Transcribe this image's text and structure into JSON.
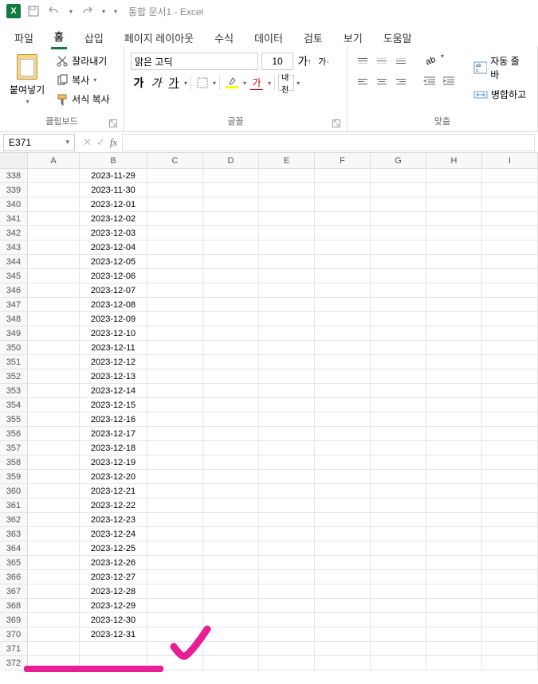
{
  "title": "통합 문서1  -  Excel",
  "tabs": [
    "파일",
    "홈",
    "삽입",
    "페이지 레이아웃",
    "수식",
    "데이터",
    "검토",
    "보기",
    "도움말"
  ],
  "active_tab": "홈",
  "clipboard": {
    "paste": "붙여넣기",
    "cut": "잘라내기",
    "copy": "복사",
    "format_painter": "서식 복사",
    "group_label": "클립보드"
  },
  "font": {
    "name": "맑은 고딕",
    "size": "10",
    "grow": "가",
    "shrink": "가",
    "bold": "가",
    "italic": "가",
    "underline": "가",
    "ruby": "내천",
    "group_label": "글꼴"
  },
  "align": {
    "wrap": "자동 줄 바",
    "merge": "병합하고",
    "group_label": "맞춤"
  },
  "name_box": "E371",
  "formula": "",
  "columns": [
    "A",
    "B",
    "C",
    "D",
    "E",
    "F",
    "G",
    "H",
    "I"
  ],
  "row_start": 338,
  "row_end": 372,
  "dates_start_row": 338,
  "dates": [
    "2023-11-29",
    "2023-11-30",
    "2023-12-01",
    "2023-12-02",
    "2023-12-03",
    "2023-12-04",
    "2023-12-05",
    "2023-12-06",
    "2023-12-07",
    "2023-12-08",
    "2023-12-09",
    "2023-12-10",
    "2023-12-11",
    "2023-12-12",
    "2023-12-13",
    "2023-12-14",
    "2023-12-15",
    "2023-12-16",
    "2023-12-17",
    "2023-12-18",
    "2023-12-19",
    "2023-12-20",
    "2023-12-21",
    "2023-12-22",
    "2023-12-23",
    "2023-12-24",
    "2023-12-25",
    "2023-12-26",
    "2023-12-27",
    "2023-12-28",
    "2023-12-29",
    "2023-12-30",
    "2023-12-31"
  ]
}
